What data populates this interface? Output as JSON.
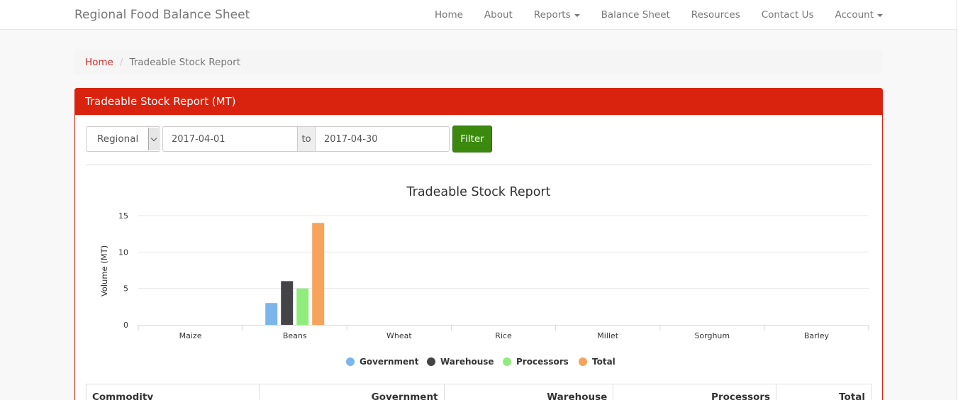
{
  "navbar": {
    "brand": "Regional Food Balance Sheet",
    "items": [
      {
        "label": "Home",
        "dropdown": false
      },
      {
        "label": "About",
        "dropdown": false
      },
      {
        "label": "Reports",
        "dropdown": true
      },
      {
        "label": "Balance Sheet",
        "dropdown": false
      },
      {
        "label": "Resources",
        "dropdown": false
      },
      {
        "label": "Contact Us",
        "dropdown": false
      },
      {
        "label": "Account",
        "dropdown": true
      }
    ]
  },
  "breadcrumb": {
    "home": "Home",
    "separator": "/",
    "active": "Tradeable Stock Report"
  },
  "panel": {
    "title": "Tradeable Stock Report (MT)"
  },
  "filter": {
    "scope": "Regional",
    "date_from": "2017-04-01",
    "addon": "to",
    "date_to": "2017-04-30",
    "button": "Filter"
  },
  "chart_data": {
    "type": "bar",
    "title": "Tradeable Stock Report",
    "xlabel": "",
    "ylabel": "Volume (MT)",
    "ylim": [
      0,
      15
    ],
    "yticks": [
      0,
      5,
      10,
      15
    ],
    "grid": true,
    "legend_position": "bottom",
    "categories": [
      "Maize",
      "Beans",
      "Wheat",
      "Rice",
      "Millet",
      "Sorghum",
      "Barley"
    ],
    "series": [
      {
        "name": "Government",
        "color": "#7cb5ec",
        "values": [
          0,
          3,
          0,
          0,
          0,
          0,
          0
        ]
      },
      {
        "name": "Warehouse",
        "color": "#434348",
        "values": [
          0,
          6,
          0,
          0,
          0,
          0,
          0
        ]
      },
      {
        "name": "Processors",
        "color": "#90ed7d",
        "values": [
          0,
          5,
          0,
          0,
          0,
          0,
          0
        ]
      },
      {
        "name": "Total",
        "color": "#f7a35c",
        "values": [
          0,
          14,
          0,
          0,
          0,
          0,
          0
        ]
      }
    ]
  },
  "table": {
    "headers": [
      "Commodity",
      "Government",
      "Warehouse",
      "Processors",
      "Total"
    ]
  }
}
